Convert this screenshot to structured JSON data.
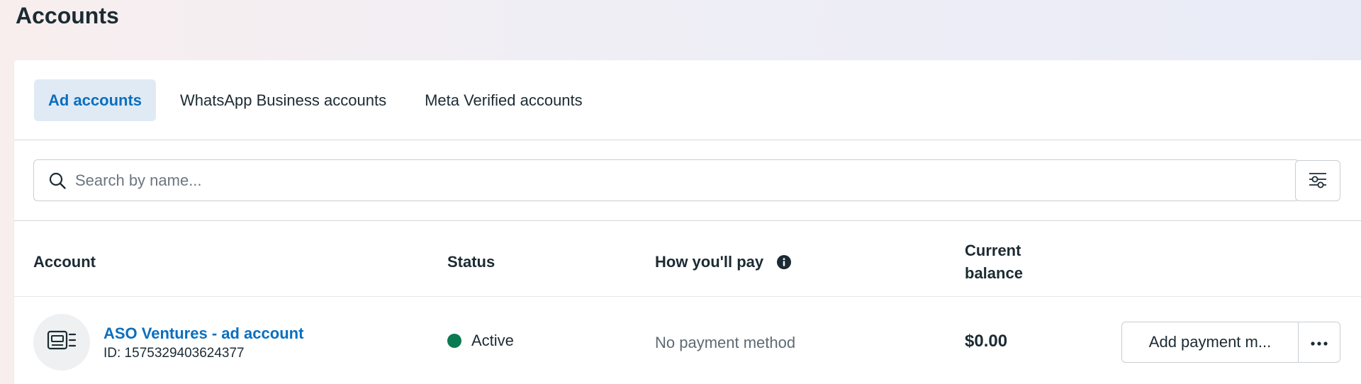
{
  "page": {
    "title": "Accounts"
  },
  "tabs": [
    {
      "label": "Ad accounts",
      "active": true
    },
    {
      "label": "WhatsApp Business accounts",
      "active": false
    },
    {
      "label": "Meta Verified accounts",
      "active": false
    }
  ],
  "search": {
    "placeholder": "Search by name...",
    "value": ""
  },
  "table": {
    "headers": {
      "account": "Account",
      "status": "Status",
      "how_pay": "How you'll pay",
      "balance": "Current balance"
    },
    "rows": [
      {
        "name": "ASO Ventures - ad account",
        "id": "ID: 1575329403624377",
        "status": "Active",
        "status_color": "#0b7a52",
        "payment": "No payment method",
        "balance": "$0.00",
        "action_label": "Add payment m..."
      }
    ]
  },
  "icons": {
    "search": "search-icon",
    "filter": "filter-sliders-icon",
    "info": "info-icon",
    "account": "ad-account-icon",
    "more": "more-options-icon"
  },
  "colors": {
    "accent": "#0a6fbf",
    "tab_active_bg": "#dfeaf5",
    "text": "#1c2b33"
  }
}
